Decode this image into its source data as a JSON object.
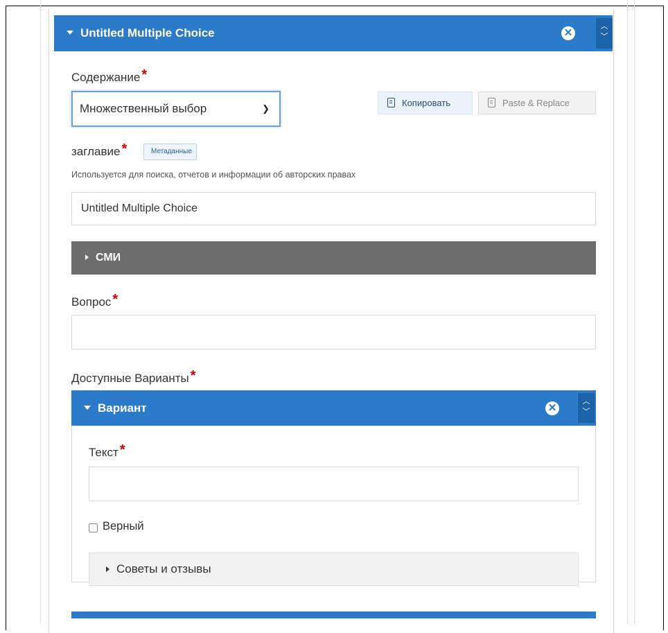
{
  "group": {
    "title": "Untitled Multiple Choice",
    "remove_icon": "remove-circle-icon",
    "move_up": "^",
    "move_down": "v"
  },
  "content": {
    "label": "Содержание",
    "required": "*",
    "select_value": "Множественный выбор",
    "copy_label": "Копировать",
    "paste_label": "Paste & Replace"
  },
  "title_field": {
    "label": "заглавие",
    "required": "*",
    "tag": "Метаданные",
    "description": "Используется для поиска, отчетов и информации об авторских правах",
    "value": "Untitled Multiple Choice"
  },
  "media": {
    "label": "СМИ"
  },
  "question": {
    "label": "Вопрос",
    "required": "*",
    "value": ""
  },
  "answers": {
    "label": "Доступные Варианты",
    "required": "*",
    "option": {
      "title": "Вариант",
      "text_label": "Текст",
      "text_required": "*",
      "text_value": "",
      "correct_label": "Верный",
      "correct_checked": false,
      "feedback_label": "Советы и отзывы"
    }
  },
  "colors": {
    "accent": "#2b7bca",
    "media_bar": "#6d6d6d",
    "required": "#cc0000"
  }
}
